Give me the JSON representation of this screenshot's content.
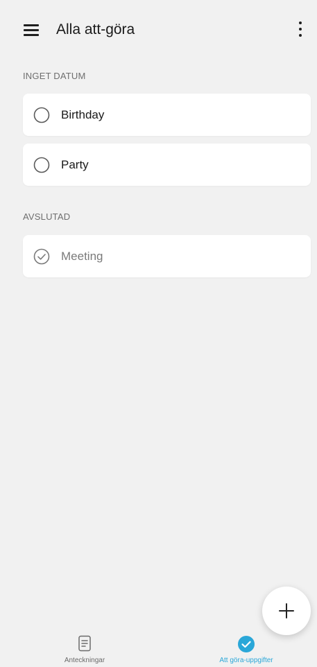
{
  "header": {
    "title": "Alla att-göra",
    "menu_icon": "hamburger-menu-icon",
    "more_icon": "more-vertical-icon"
  },
  "sections": [
    {
      "header": "INGET DATUM",
      "items": [
        {
          "label": "Birthday",
          "done": false
        },
        {
          "label": "Party",
          "done": false
        }
      ]
    },
    {
      "header": "AVSLUTAD",
      "items": [
        {
          "label": "Meeting",
          "done": true
        }
      ]
    }
  ],
  "fab": {
    "icon": "plus-icon"
  },
  "bottom_nav": {
    "items": [
      {
        "label": "Anteckningar",
        "icon": "note-icon",
        "active": false
      },
      {
        "label": "Att göra-uppgifter",
        "icon": "check-circle-icon",
        "active": true
      }
    ]
  },
  "colors": {
    "background": "#f1f1f1",
    "card": "#ffffff",
    "accent": "#2aa7d8",
    "text": "#1a1a1a",
    "muted": "#6e6e6e"
  }
}
